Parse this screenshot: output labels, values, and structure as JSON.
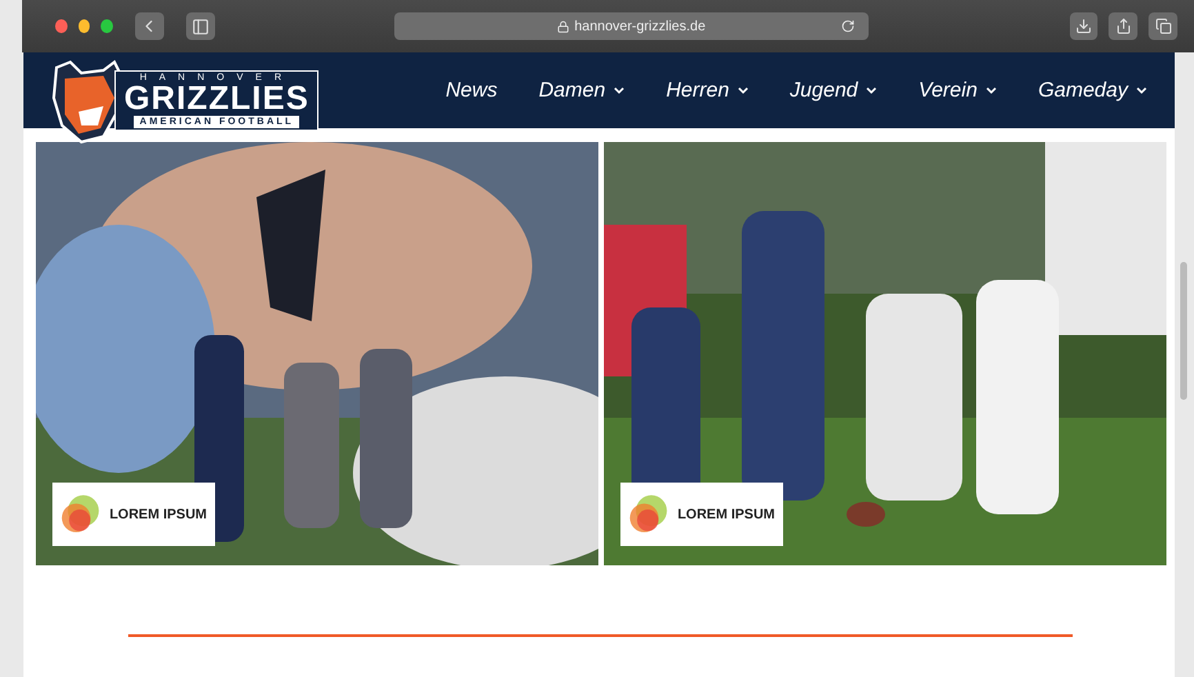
{
  "browser": {
    "url": "hannover-grizzlies.de"
  },
  "logo": {
    "top": "HANNOVER",
    "name": "GRIZZLIES",
    "bottom": "AMERICAN FOOTBALL"
  },
  "nav": [
    {
      "label": "News",
      "dropdown": false
    },
    {
      "label": "Damen",
      "dropdown": true
    },
    {
      "label": "Herren",
      "dropdown": true
    },
    {
      "label": "Jugend",
      "dropdown": true
    },
    {
      "label": "Verein",
      "dropdown": true
    },
    {
      "label": "Gameday",
      "dropdown": true
    }
  ],
  "slides": [
    {
      "kind": "picture",
      "sponsor": "LOREM IPSUM"
    },
    {
      "kind": "picture",
      "sponsor": "LOREM IPSUM"
    }
  ]
}
